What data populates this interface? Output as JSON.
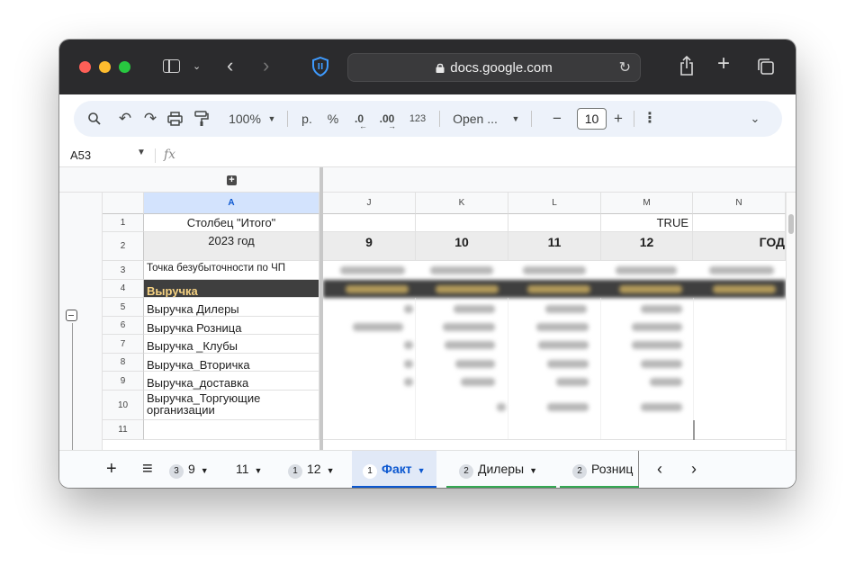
{
  "browser": {
    "url": "docs.google.com"
  },
  "toolbar": {
    "zoom": "100%",
    "currency": "р.",
    "percent": "%",
    "decrease_decimals": ".0",
    "increase_decimals": ".00",
    "number_format": "123",
    "font": "Open ...",
    "font_size": "10",
    "minus": "−",
    "plus": "+",
    "more": "⋮"
  },
  "formula_bar": {
    "cell_ref": "A53",
    "fx": "fx"
  },
  "columns": {
    "A": "A",
    "right": [
      "J",
      "K",
      "L",
      "M",
      "N"
    ]
  },
  "rows": [
    {
      "num": "1",
      "a": "Столбец \"Итого\"",
      "m": "TRUE"
    },
    {
      "num": "2",
      "a": "2023 год",
      "j": "9",
      "k": "10",
      "l": "11",
      "m": "12",
      "n": "ГОД"
    },
    {
      "num": "3",
      "a": "Точка безубыточности по ЧП"
    },
    {
      "num": "4",
      "a": "Выручка"
    },
    {
      "num": "5",
      "a": "Выручка Дилеры"
    },
    {
      "num": "6",
      "a": "Выручка Розница"
    },
    {
      "num": "7",
      "a": "Выручка _Клубы"
    },
    {
      "num": "8",
      "a": "Выручка_Вторичка"
    },
    {
      "num": "9",
      "a": "Выручка_доставка"
    },
    {
      "num": "10",
      "a": "Выручка_Торгующие организации"
    },
    {
      "num": "11",
      "a": ""
    }
  ],
  "tabs": {
    "add": "+",
    "all": "≡",
    "items": [
      {
        "badge": "3",
        "label": "9"
      },
      {
        "badge": "",
        "label": "11"
      },
      {
        "badge": "1",
        "label": "12"
      },
      {
        "badge": "1",
        "label": "Факт"
      },
      {
        "badge": "2",
        "label": "Дилеры"
      },
      {
        "badge": "2",
        "label": "Розниц"
      }
    ],
    "prev": "‹",
    "next": "›"
  },
  "colors": {
    "accent": "#0b57d0",
    "header_row": "#3f3f3f",
    "header_text": "#f6d282",
    "tab_green": "#34a853"
  }
}
